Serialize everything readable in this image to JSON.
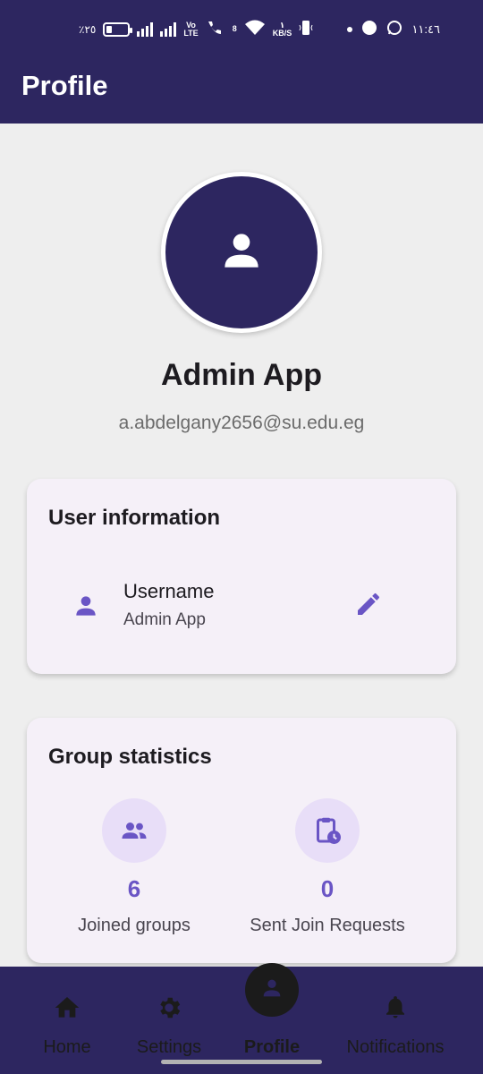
{
  "status_bar": {
    "battery_text": "٪٢٥",
    "battery_level": 0.25,
    "network_label_top": "Vo",
    "network_label_bottom": "LTE",
    "sim_number": "8",
    "speed_value": "١",
    "speed_unit": "KB/S",
    "time": "١١:٤٦",
    "icons": [
      "battery-icon",
      "signal-icon",
      "signal-icon",
      "volte-icon",
      "call-icon",
      "wifi-icon",
      "data-speed-icon",
      "vibrate-icon",
      "dot-icon",
      "app-icon",
      "whatsapp-icon"
    ]
  },
  "app_bar": {
    "title": "Profile"
  },
  "profile": {
    "avatar_icon": "person-icon",
    "name": "Admin App",
    "email": "a.abdelgany2656@su.edu.eg"
  },
  "user_info": {
    "title": "User information",
    "row_icon": "person-icon",
    "field_label": "Username",
    "field_value": "Admin App",
    "edit_icon": "edit-pencil-icon"
  },
  "group_stats": {
    "title": "Group statistics",
    "items": [
      {
        "icon": "groups-icon",
        "value": "6",
        "label": "Joined groups"
      },
      {
        "icon": "pending-clipboard-icon",
        "value": "0",
        "label": "Sent Join Requests"
      }
    ]
  },
  "bottom_nav": {
    "items": [
      {
        "icon": "home-icon",
        "label": "Home"
      },
      {
        "icon": "settings-gear-icon",
        "label": "Settings"
      },
      {
        "icon": "person-icon",
        "label": "Profile",
        "active": true
      },
      {
        "icon": "bell-icon",
        "label": "Notifications"
      }
    ]
  },
  "colors": {
    "primary": "#2d2660",
    "accent": "#6a55c5",
    "card_background": "#f5f0f8",
    "page_background": "#eeeeee",
    "icon_circle": "#e8def8"
  }
}
